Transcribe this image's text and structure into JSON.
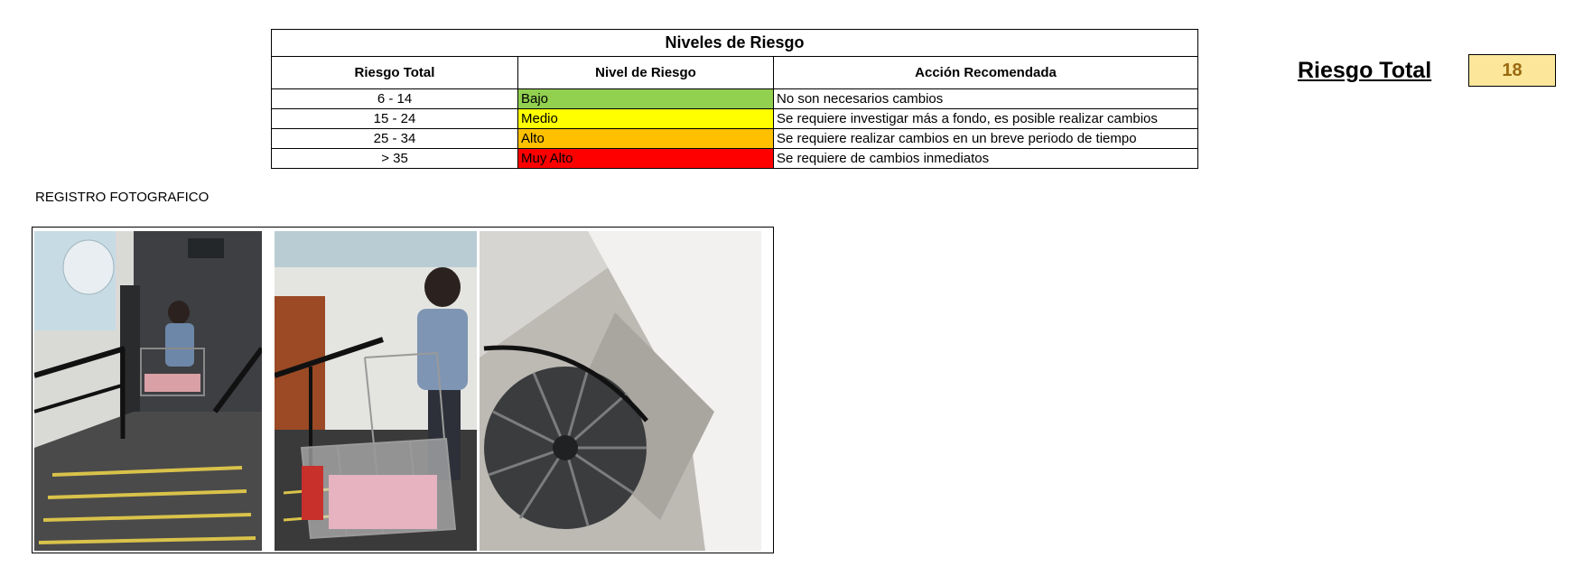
{
  "risk_table": {
    "title": "Niveles de Riesgo",
    "headers": [
      "Riesgo Total",
      "Nivel de Riesgo",
      "Acción Recomendada"
    ],
    "rows": [
      {
        "range": "6 - 14",
        "level": "Bajo",
        "action": "No son necesarios cambios",
        "color": "#92d050"
      },
      {
        "range": "15 - 24",
        "level": "Medio",
        "action": "Se requiere investigar más a fondo, es posible realizar cambios",
        "color": "#ffff00"
      },
      {
        "range": "25 - 34",
        "level": "Alto",
        "action": "Se requiere realizar cambios en un breve periodo de tiempo",
        "color": "#ffc000"
      },
      {
        "range": "> 35",
        "level": "Muy Alto",
        "action": "Se requiere de cambios inmediatos",
        "color": "#ff0000"
      }
    ]
  },
  "total": {
    "label": "Riesgo Total",
    "value": "18",
    "box_color": "#fbe69a"
  },
  "photos": {
    "section_title": "REGISTRO FOTOGRAFICO",
    "items": [
      {
        "subject": "worker pushing cart down ramp"
      },
      {
        "subject": "worker with shopping cart close-up"
      },
      {
        "subject": "spiral staircase"
      }
    ]
  }
}
